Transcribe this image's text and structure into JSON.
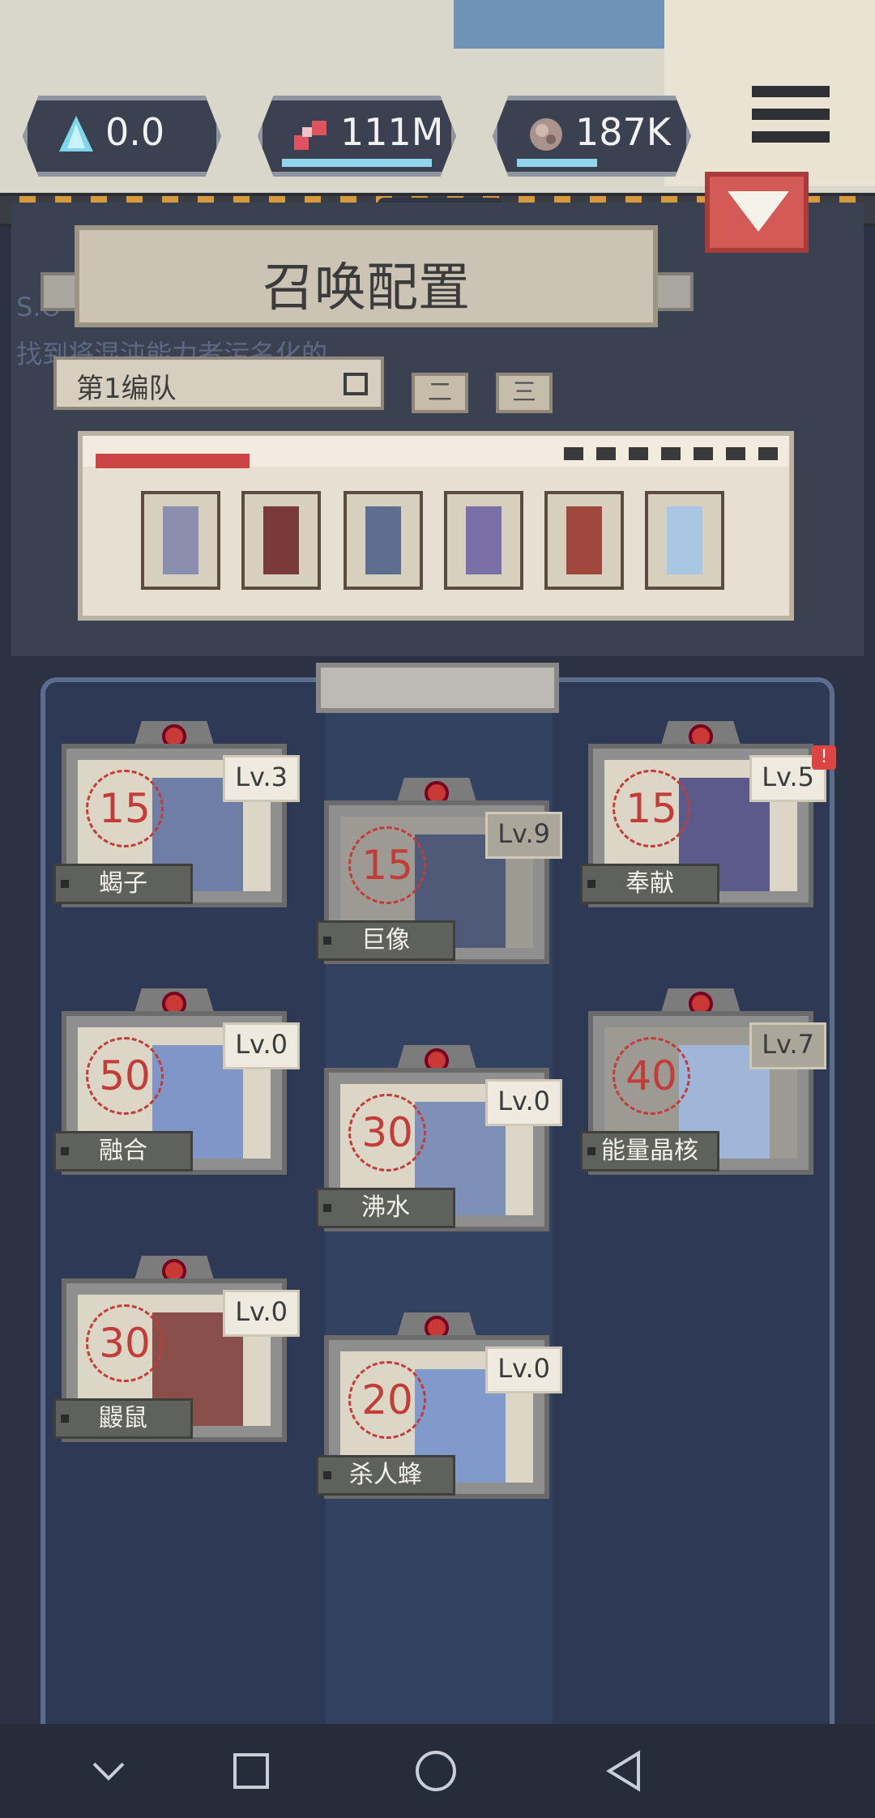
{
  "resources": [
    {
      "name": "crystal",
      "icon": "crystal-icon",
      "value": "0.0"
    },
    {
      "name": "blood",
      "icon": "blood-cells-icon",
      "value": "111M"
    },
    {
      "name": "flesh",
      "icon": "flesh-chunk-icon",
      "value": "187K"
    }
  ],
  "header": {
    "title": "召唤配置"
  },
  "background_text": {
    "line1": "S.O",
    "line2": "找到将混沌能力者污名化的"
  },
  "team": {
    "selected": "第1编队",
    "tabs": [
      "二",
      "三"
    ]
  },
  "roster_slots": 6,
  "cards": [
    {
      "name": "蝎子",
      "cost": "15",
      "level": "Lv.3",
      "dim": false,
      "alert": false
    },
    {
      "name": "巨像",
      "cost": "15",
      "level": "Lv.9",
      "dim": true,
      "alert": false
    },
    {
      "name": "奉献",
      "cost": "15",
      "level": "Lv.5",
      "dim": false,
      "alert": true
    },
    {
      "name": "融合",
      "cost": "50",
      "level": "Lv.0",
      "dim": false,
      "alert": false
    },
    {
      "name": "沸水",
      "cost": "30",
      "level": "Lv.0",
      "dim": false,
      "alert": false
    },
    {
      "name": "能量晶核",
      "cost": "40",
      "level": "Lv.7",
      "dim": true,
      "alert": false
    },
    {
      "name": "鼹鼠",
      "cost": "30",
      "level": "Lv.0",
      "dim": false,
      "alert": false
    },
    {
      "name": "杀人蜂",
      "cost": "20",
      "level": "Lv.0",
      "dim": false,
      "alert": false
    }
  ],
  "colors": {
    "accent": "#d35a55",
    "panel": "#2e3a55",
    "cost": "#c33c38"
  }
}
